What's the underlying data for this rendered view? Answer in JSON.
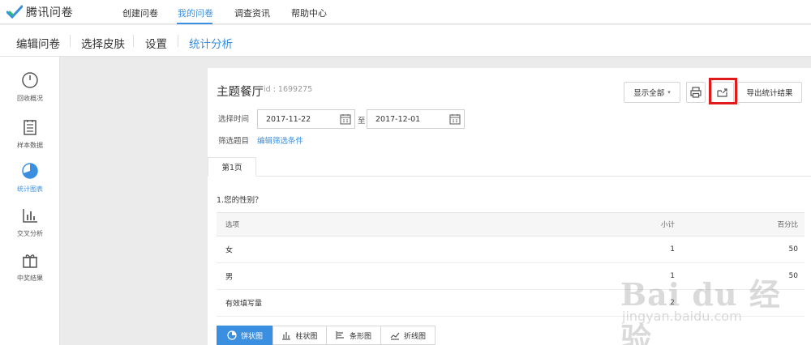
{
  "app": {
    "logo_text": "腾讯问卷"
  },
  "topnav": {
    "items": [
      "创建问卷",
      "我的问卷",
      "调查资讯",
      "帮助中心"
    ]
  },
  "subnav": {
    "items": [
      "编辑问卷",
      "选择皮肤",
      "设置",
      "统计分析"
    ]
  },
  "sidebar": {
    "items": [
      {
        "label": "回收概况",
        "icon": "clock-icon"
      },
      {
        "label": "样本数据",
        "icon": "document-icon"
      },
      {
        "label": "统计图表",
        "icon": "pie-chart-icon"
      },
      {
        "label": "交叉分析",
        "icon": "bar-chart-icon"
      },
      {
        "label": "中奖结果",
        "icon": "gift-icon"
      }
    ]
  },
  "survey": {
    "title": "主题餐厅",
    "id_text": "id : 1699275"
  },
  "toolbar": {
    "show_all": "显示全部",
    "export": "导出统计结果"
  },
  "filter": {
    "time_label": "选择时间",
    "start_date": "2017-11-22",
    "to_label": "至",
    "end_date": "2017-12-01",
    "question_label": "筛选题目",
    "edit_link": "编辑筛选条件"
  },
  "tabs": {
    "page1": "第1页"
  },
  "question": {
    "text": "1.您的性别？",
    "headers": {
      "option": "选项",
      "count": "小计",
      "percent": "百分比"
    },
    "rows": [
      {
        "option": "女",
        "count": "1",
        "percent": "50"
      },
      {
        "option": "男",
        "count": "1",
        "percent": "50"
      },
      {
        "option": "有效填写量",
        "count": "2",
        "percent": ""
      }
    ]
  },
  "chart_types": [
    "饼状图",
    "柱状图",
    "条形图",
    "折线图"
  ],
  "watermark": {
    "big": "Bai du 经验",
    "small": "jingyan.baidu.com"
  },
  "colors": {
    "accent": "#3b8fe0",
    "highlight": "#e0191b"
  }
}
